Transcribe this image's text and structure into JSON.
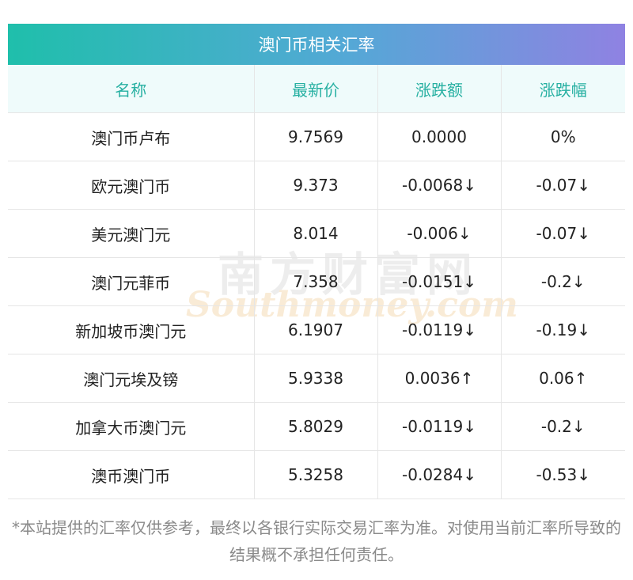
{
  "header": {
    "title": "澳门币相关汇率"
  },
  "table": {
    "columns": [
      "名称",
      "最新价",
      "涨跌额",
      "涨跌幅"
    ],
    "rows": [
      {
        "name": "澳门币卢布",
        "price": "9.7569",
        "change": "0.0000",
        "pct": "0%",
        "trend": "neutral"
      },
      {
        "name": "欧元澳门币",
        "price": "9.373",
        "change": "-0.0068↓",
        "pct": "-0.07↓",
        "trend": "down"
      },
      {
        "name": "美元澳门元",
        "price": "8.014",
        "change": "-0.006↓",
        "pct": "-0.07↓",
        "trend": "down"
      },
      {
        "name": "澳门元菲币",
        "price": "7.358",
        "change": "-0.0151↓",
        "pct": "-0.2↓",
        "trend": "down"
      },
      {
        "name": "新加坡币澳门元",
        "price": "6.1907",
        "change": "-0.0119↓",
        "pct": "-0.19↓",
        "trend": "down"
      },
      {
        "name": "澳门元埃及镑",
        "price": "5.9338",
        "change": "0.0036↑",
        "pct": "0.06↑",
        "trend": "up"
      },
      {
        "name": "加拿大币澳门元",
        "price": "5.8029",
        "change": "-0.0119↓",
        "pct": "-0.2↓",
        "trend": "down"
      },
      {
        "name": "澳币澳门币",
        "price": "5.3258",
        "change": "-0.0284↓",
        "pct": "-0.53↓",
        "trend": "down"
      }
    ]
  },
  "watermark": {
    "zh": "南方财富网",
    "en": "Southmoney.com"
  },
  "footnote": "*本站提供的汇率仅供参考，最终以各银行实际交易汇率为准。对使用当前汇率所导致的结果概不承担任何责任。",
  "colors": {
    "up": "#f40f0f",
    "down": "#1c8c1c",
    "neutral": "#222222",
    "header_text": "#27b0a2",
    "header_bg": "#effbfb",
    "title_gradient": [
      "#1fbfab",
      "#8f82e2"
    ]
  }
}
